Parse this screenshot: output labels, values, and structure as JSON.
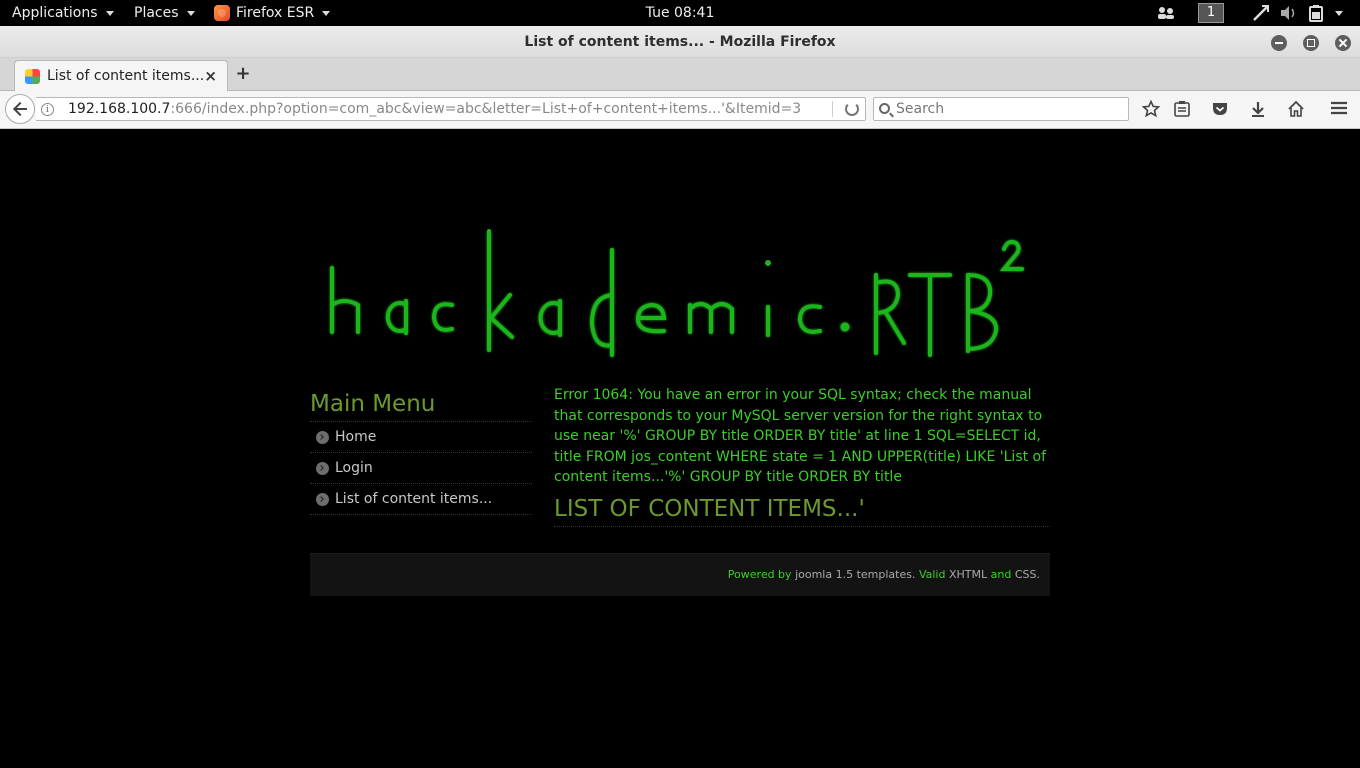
{
  "topbar": {
    "applications": "Applications",
    "places": "Places",
    "firefox": "Firefox ESR",
    "clock": "Tue 08:41",
    "workspace": "1"
  },
  "window": {
    "title": "List of content items... - Mozilla Firefox"
  },
  "tab": {
    "label": "List of content items...",
    "close": "×",
    "new_tab": "+"
  },
  "navbar": {
    "url_host": "192.168.100.7",
    "url_rest": ":666/index.php?option=com_abc&view=abc&letter=List+of+content+items...'&Itemid=3",
    "search_placeholder": "Search"
  },
  "page": {
    "logo_text": "hackademic.RTB²",
    "menu_title": "Main Menu",
    "menu_items": [
      "Home",
      "Login",
      "List of content items..."
    ],
    "sql_error": "Error 1064: You have an error in your SQL syntax; check the manual that corresponds to your MySQL server version for the right syntax to use near '%' GROUP BY title ORDER BY title' at line 1 SQL=SELECT id, title FROM jos_content WHERE state = 1 AND UPPER(title) LIKE 'List of content items...'%' GROUP BY title ORDER BY title",
    "heading": "LIST OF CONTENT ITEMS...'",
    "footer": {
      "powered_by": "Powered by",
      "joomla": "joomla 1.5 templates.",
      "valid": "Valid",
      "xhtml": "XHTML",
      "and": "and",
      "css": "CSS."
    }
  },
  "colors": {
    "error_green": "#3ccf27",
    "heading_olive": "#6c9a2f",
    "logo_green": "#1db51d"
  }
}
